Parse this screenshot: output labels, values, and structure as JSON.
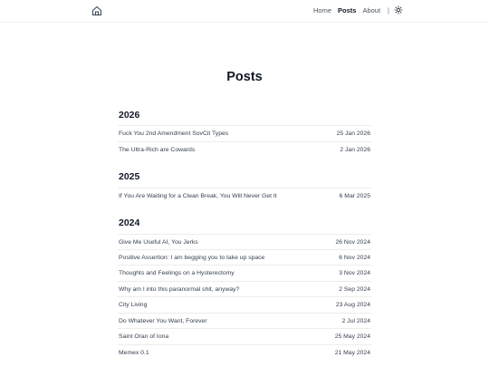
{
  "nav": {
    "items": [
      "Home",
      "Posts",
      "About"
    ],
    "separator": "|"
  },
  "page": {
    "title": "Posts"
  },
  "sections": [
    {
      "year": "2026",
      "posts": [
        {
          "title": "Fuck You 2nd Amendment SovCit Types",
          "date": "25 Jan 2026"
        },
        {
          "title": "The Ultra-Rich are Cowards",
          "date": "2 Jan 2026"
        }
      ]
    },
    {
      "year": "2025",
      "posts": [
        {
          "title": "If You Are Waiting for a Clean Break, You Will Never Get It",
          "date": "6 Mar 2025"
        }
      ]
    },
    {
      "year": "2024",
      "posts": [
        {
          "title": "Give Me Useful AI, You Jerks",
          "date": "26 Nov 2024"
        },
        {
          "title": "Positive Assertion: I am begging you to take up space",
          "date": "6 Nov 2024"
        },
        {
          "title": "Thoughts and Feelings on a Hysterectomy",
          "date": "3 Nov 2024"
        },
        {
          "title": "Why am I into this paranormal shit, anyway?",
          "date": "2 Sep 2024"
        },
        {
          "title": "City Living",
          "date": "23 Aug 2024"
        },
        {
          "title": "Do Whatever You Want, Forever",
          "date": "2 Jul 2024"
        },
        {
          "title": "Saint Oran of Iona",
          "date": "25 May 2024"
        },
        {
          "title": "Memex 0.1",
          "date": "21 May 2024"
        }
      ]
    }
  ],
  "icons": {
    "home": "home-icon",
    "theme": "sun-icon"
  }
}
